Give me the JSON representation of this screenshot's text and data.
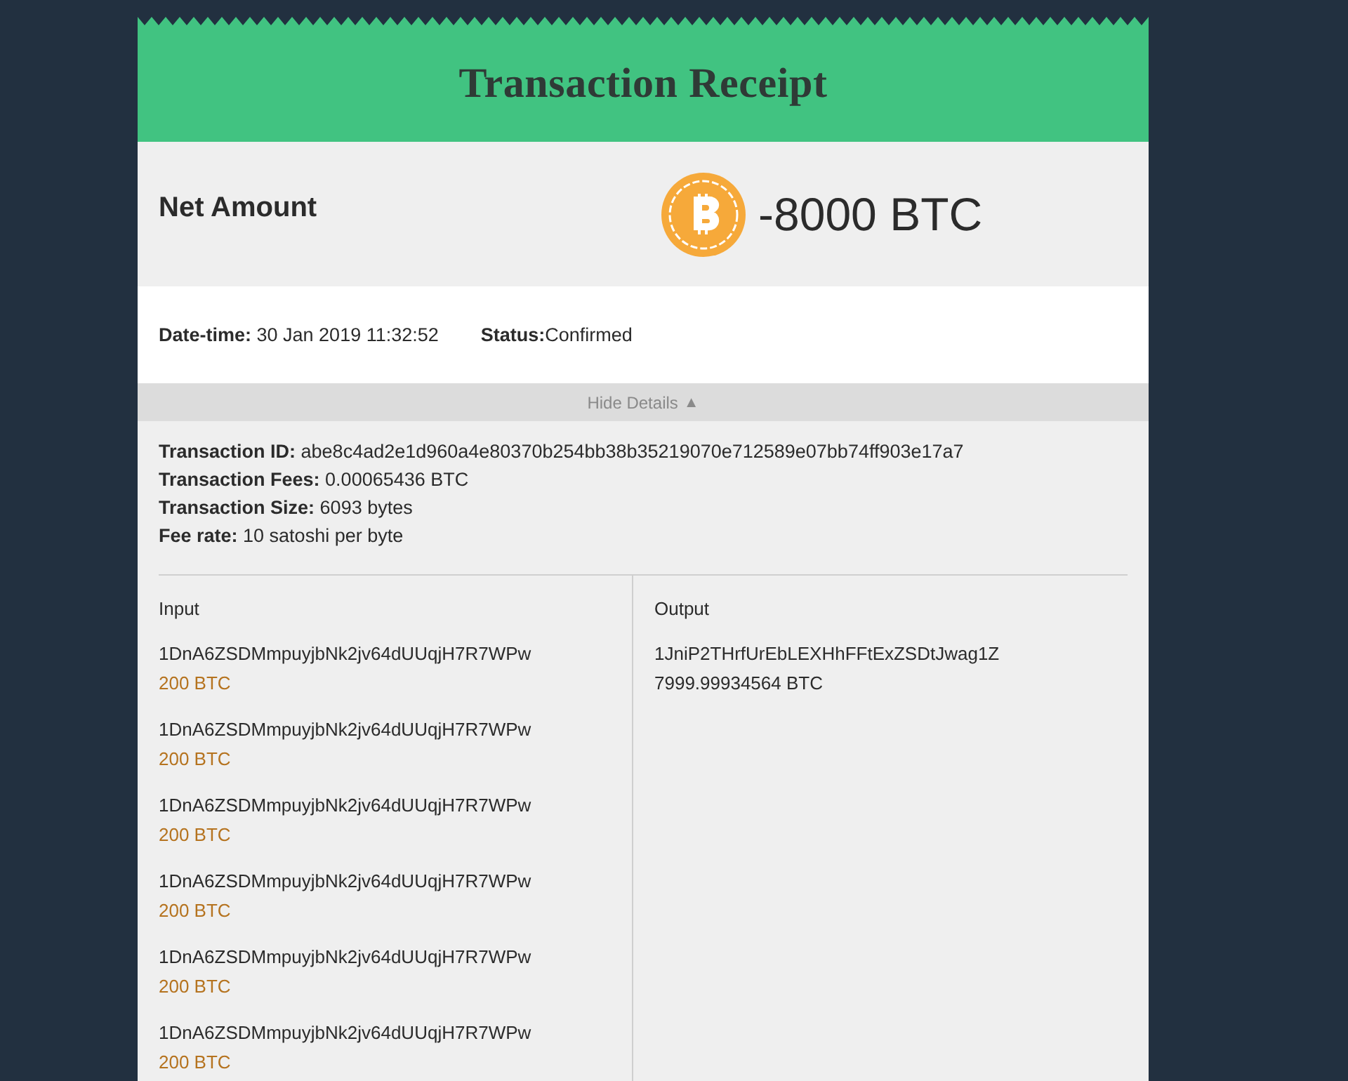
{
  "header": {
    "title": "Transaction Receipt"
  },
  "net_amount": {
    "label": "Net Amount",
    "value": "-8000 BTC"
  },
  "meta": [
    {
      "label": "Date-time:",
      "value": "30 Jan 2019 11:32:52"
    },
    {
      "label": "Status:",
      "value": "Confirmed"
    }
  ],
  "details_toggle": {
    "label": "Hide Details",
    "icon": "▲",
    "expanded": true
  },
  "details": [
    {
      "label": "Transaction ID:",
      "value": "abe8c4ad2e1d960a4e80370b254bb38b35219070e712589e07bb74ff903e17a7"
    },
    {
      "label": "Transaction Fees:",
      "value": "0.00065436 BTC"
    },
    {
      "label": "Transaction Size:",
      "value": "6093 bytes"
    },
    {
      "label": "Fee rate:",
      "value": "10 satoshi per byte"
    }
  ],
  "input": {
    "heading": "Input",
    "entries": [
      {
        "address": "1DnA6ZSDMmpuyjbNk2jv64dUUqjH7R7WPw",
        "amount": "200 BTC"
      },
      {
        "address": "1DnA6ZSDMmpuyjbNk2jv64dUUqjH7R7WPw",
        "amount": "200 BTC"
      },
      {
        "address": "1DnA6ZSDMmpuyjbNk2jv64dUUqjH7R7WPw",
        "amount": "200 BTC"
      },
      {
        "address": "1DnA6ZSDMmpuyjbNk2jv64dUUqjH7R7WPw",
        "amount": "200 BTC"
      },
      {
        "address": "1DnA6ZSDMmpuyjbNk2jv64dUUqjH7R7WPw",
        "amount": "200 BTC"
      },
      {
        "address": "1DnA6ZSDMmpuyjbNk2jv64dUUqjH7R7WPw",
        "amount": "200 BTC"
      }
    ]
  },
  "output": {
    "heading": "Output",
    "entries": [
      {
        "address": "1JniP2THrfUrEbLEXHhFFtExZSDtJwag1Z",
        "amount": "7999.99934564 BTC"
      }
    ]
  }
}
